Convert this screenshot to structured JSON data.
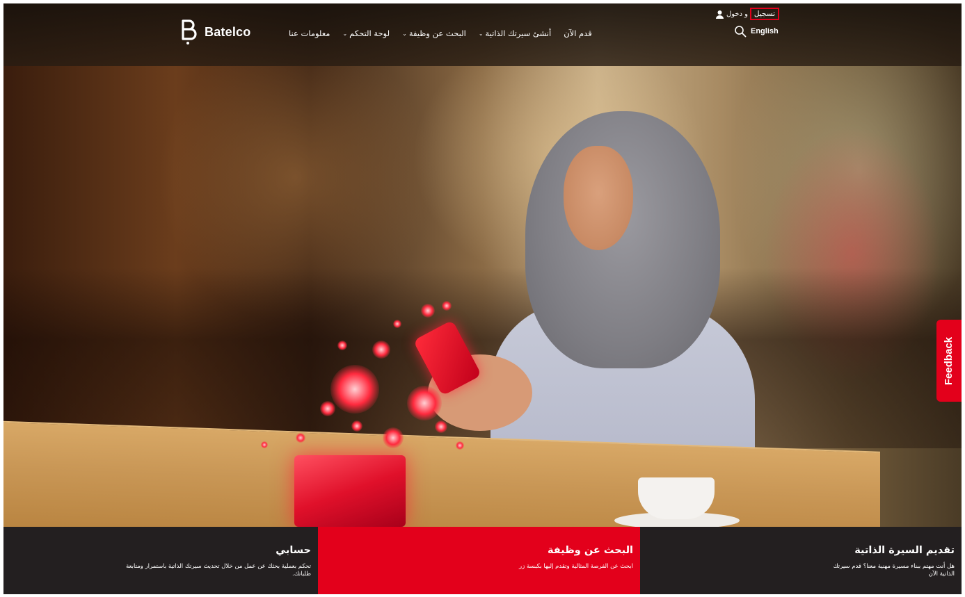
{
  "header": {
    "brand": "Batelco",
    "nav": [
      {
        "label": "معلومات عنا",
        "dropdown": false
      },
      {
        "label": "لوحة التحكم",
        "dropdown": true
      },
      {
        "label": "البحث عن وظيفة",
        "dropdown": true
      },
      {
        "label": "أنشئ سيرتك الذاتية",
        "dropdown": true
      },
      {
        "label": "قدم الآن",
        "dropdown": false
      }
    ],
    "register": "تسجيل",
    "and": "و",
    "login": "دخول",
    "language": "English"
  },
  "feedback": "Feedback",
  "tiles": {
    "profile": {
      "title": "حسابي",
      "text": "تحكم بعملية بحثك عن عمل من خلال تحديث سيرتك الذاتية باستمرار ومتابعة طلباتك."
    },
    "jobs": {
      "title": "البحث عن وظيفة",
      "text": "ابحث عن الفرصة المثالية وتقدم إليها بكبسة زر"
    },
    "cv": {
      "title": "تقديم السيرة الذاتية",
      "text": "هل أنت مهتم ببناء مسيرة مهنية معنا؟ قدم سيرتك الذاتية الآن"
    }
  },
  "colors": {
    "brand_red": "#e3001b",
    "dark_tile": "#231f20"
  },
  "icons": [
    "user-icon",
    "search-icon",
    "batelco-logo-icon",
    "chevron-down-icon"
  ]
}
